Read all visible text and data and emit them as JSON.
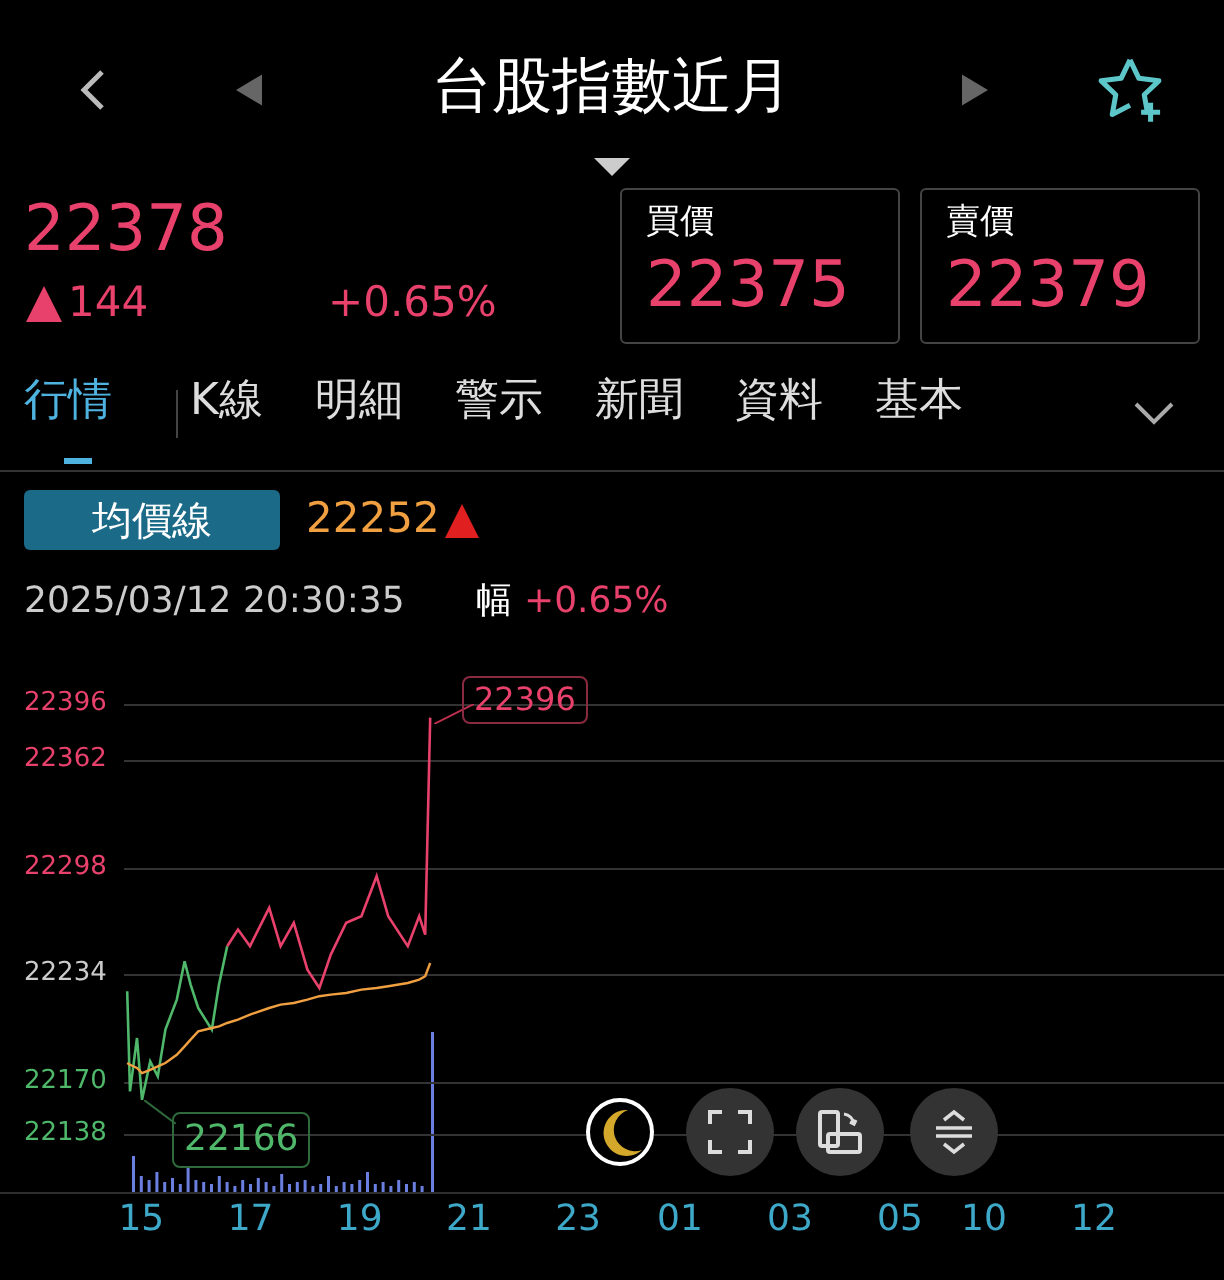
{
  "header": {
    "title": "台股指數近月"
  },
  "quote": {
    "price": "22378",
    "change": "144",
    "change_percent": "+0.65%",
    "up": true
  },
  "bid_ask": [
    {
      "label": "買價",
      "value": "22375"
    },
    {
      "label": "賣價",
      "value": "22379"
    }
  ],
  "tabs": [
    {
      "label": "行情",
      "selected": true
    },
    {
      "label": "K線",
      "selected": false
    },
    {
      "label": "明細",
      "selected": false
    },
    {
      "label": "警示",
      "selected": false
    },
    {
      "label": "新聞",
      "selected": false
    },
    {
      "label": "資料",
      "selected": false
    },
    {
      "label": "基本",
      "selected": false
    }
  ],
  "indicator": {
    "button": "均價線",
    "value": "22252",
    "up": true
  },
  "info": {
    "datetime": "2025/03/12 20:30:35",
    "label": "幅",
    "change_percent": "+0.65%"
  },
  "chart": {
    "high_marker": "22396",
    "low_marker": "22166",
    "next_day_labels": [
      "01",
      "03",
      "05",
      "10",
      "12"
    ],
    "chart_data": {
      "type": "line",
      "x": [
        14.74,
        14.79,
        14.92,
        15.01,
        15.16,
        15.3,
        15.44,
        15.65,
        15.79,
        15.9,
        16.04,
        16.29,
        16.42,
        16.57,
        16.77,
        16.99,
        17.34,
        17.55,
        17.79,
        18.04,
        18.26,
        18.47,
        18.75,
        19.03,
        19.31,
        19.52,
        19.88,
        20.09,
        20.2,
        20.29
      ],
      "series": [
        {
          "color": "#4fb86a",
          "values": [
            22224,
            22164,
            22196,
            22159,
            22182,
            22173,
            22201,
            22219,
            22242,
            22228,
            22214,
            22201,
            22228,
            22251,
            null,
            null,
            null,
            null,
            null,
            null,
            null,
            null,
            null,
            null,
            null,
            null,
            null,
            null,
            null,
            null
          ]
        },
        {
          "color": "#e8416b",
          "values": [
            null,
            null,
            null,
            null,
            null,
            null,
            null,
            null,
            null,
            null,
            null,
            null,
            null,
            22251,
            22261,
            22251,
            22274,
            22251,
            22265,
            22237,
            22226,
            22246,
            22265,
            22269,
            22293,
            22269,
            22251,
            22269,
            22258,
            22388
          ]
        },
        {
          "color": "#f0a040",
          "values": [
            22181,
            22180,
            22178,
            22175,
            22177,
            22179,
            22181,
            22186,
            22191,
            22195,
            22200,
            22202,
            22203,
            22205,
            22207,
            22210,
            22214,
            22216,
            22217,
            22219,
            22221,
            22222,
            22223,
            22225,
            22226,
            22227,
            22229,
            22231,
            22233,
            22241
          ]
        }
      ],
      "xlim": [
        12.41,
        34.83
      ],
      "ylim": [
        22051,
        22818
      ],
      "yticks": [
        {
          "value": 22396,
          "label": "22396"
        },
        {
          "value": 22362,
          "label": "22362"
        },
        {
          "value": 22298,
          "label": "22298"
        },
        {
          "value": 22234,
          "label": "22234"
        },
        {
          "value": 22170,
          "label": "22170"
        },
        {
          "value": 22138,
          "label": "22138"
        }
      ],
      "xticks": [
        {
          "value": 15,
          "label": "15"
        },
        {
          "value": 17,
          "label": "17"
        },
        {
          "value": 19,
          "label": "19"
        },
        {
          "value": 21,
          "label": "21"
        },
        {
          "value": 23,
          "label": "23"
        }
      ]
    }
  }
}
